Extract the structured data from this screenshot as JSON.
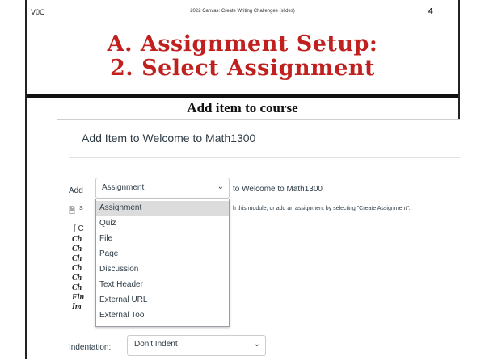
{
  "slide": {
    "code": "V0C",
    "header_title": "2022 Canvas: Create Writing Challenges (slides)",
    "page_number": "4",
    "title_line1": "A. Assignment Setup:",
    "title_line2": "2. Select Assignment",
    "subtitle": "Add item to course",
    "title_color": "#c0211f"
  },
  "dialog": {
    "title": "Add Item to Welcome to Math1300",
    "add_label": "Add",
    "add_select_value": "Assignment",
    "to_text": "to Welcome to Math1300",
    "help_text_start": "S",
    "help_text_end": "h this module, or add an assignment by selecting \"Create Assignment\".",
    "background_list_open": "[ C",
    "background_items": [
      "Ch",
      "Ch",
      "Ch",
      "Ch",
      "Ch",
      "Ch",
      "Fin",
      "Im"
    ],
    "dropdown_options": [
      "Assignment",
      "Quiz",
      "File",
      "Page",
      "Discussion",
      "Text Header",
      "External URL",
      "External Tool"
    ],
    "dropdown_selected": "Assignment",
    "indentation_label": "Indentation:",
    "indentation_value": "Don't Indent"
  }
}
